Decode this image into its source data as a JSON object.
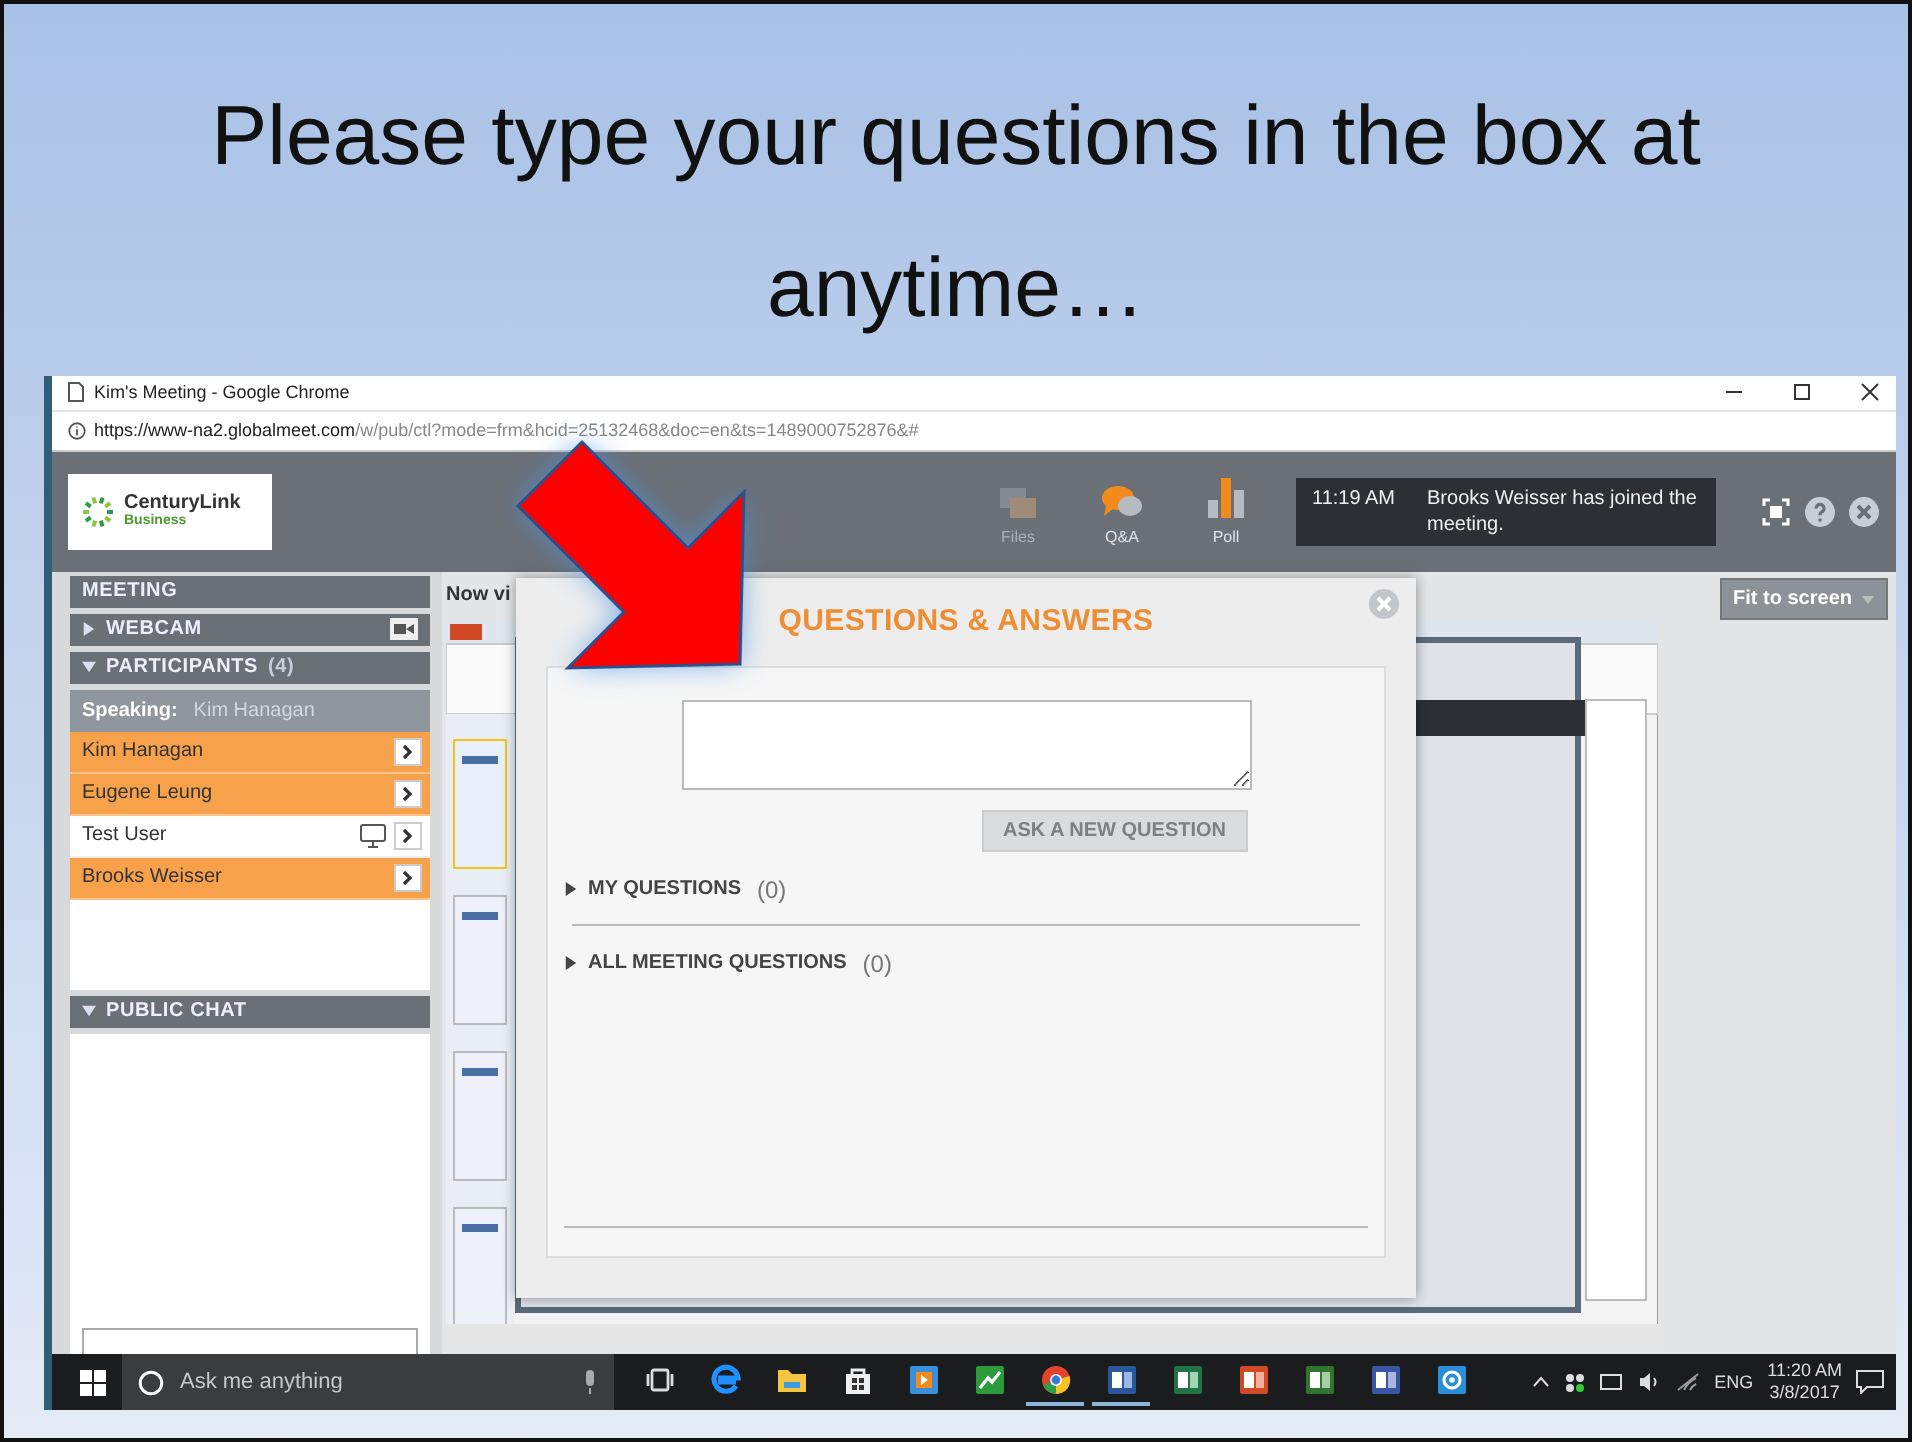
{
  "slide_title": "Please type your questions in the box at anytime…",
  "browser": {
    "title": "Kim's Meeting - Google Chrome",
    "url_host": "https://www-na2.globalmeet.com",
    "url_path": "/w/pub/ctl?mode=frm&hcid=25132468&doc=en&ts=1489000752876&#"
  },
  "header": {
    "logo_name": "CenturyLink",
    "logo_sub": "Business",
    "tools": [
      {
        "kind": "files",
        "label": "Files",
        "disabled": true
      },
      {
        "kind": "qa",
        "label": "Q&A",
        "disabled": false
      },
      {
        "kind": "poll",
        "label": "Poll",
        "disabled": false
      }
    ],
    "notification": {
      "time": "11:19 AM",
      "message": "Brooks Weisser has joined the meeting."
    }
  },
  "sidebar": {
    "heading": "MEETING",
    "webcam": {
      "label": "WEBCAM",
      "expanded": false
    },
    "participants": {
      "label": "PARTICIPANTS",
      "count": "(4)",
      "expanded": true,
      "speaking_label": "Speaking:",
      "speaking_name": "Kim Hanagan",
      "items": [
        {
          "name": "Kim Hanagan",
          "highlighted": true,
          "presenter": false
        },
        {
          "name": "Eugene Leung",
          "highlighted": true,
          "presenter": false
        },
        {
          "name": "Test User",
          "highlighted": false,
          "presenter": true
        },
        {
          "name": "Brooks Weisser",
          "highlighted": true,
          "presenter": false
        }
      ]
    },
    "public_chat": {
      "label": "PUBLIC CHAT",
      "expanded": true
    }
  },
  "content": {
    "now_viewing": "Now vi",
    "fit_button": "Fit to screen"
  },
  "qa_dialog": {
    "title": "QUESTIONS & ANSWERS",
    "ask_button": {
      "label": "ASK A NEW QUESTION",
      "disabled": true
    },
    "sections": [
      {
        "label": "MY QUESTIONS",
        "count": "(0)",
        "expanded": false
      },
      {
        "label": "ALL MEETING QUESTIONS",
        "count": "(0)",
        "expanded": false
      }
    ]
  },
  "taskbar": {
    "search_placeholder": "Ask me anything",
    "apps": [
      {
        "kind": "taskview",
        "running": false
      },
      {
        "kind": "edge",
        "running": false
      },
      {
        "kind": "explorer",
        "running": false
      },
      {
        "kind": "store",
        "running": false
      },
      {
        "kind": "media",
        "running": false
      },
      {
        "kind": "chart",
        "running": false
      },
      {
        "kind": "chrome",
        "running": true
      },
      {
        "kind": "word",
        "running": true
      },
      {
        "kind": "excel",
        "running": false
      },
      {
        "kind": "powerpoint",
        "running": false
      },
      {
        "kind": "project",
        "running": false
      },
      {
        "kind": "visio",
        "running": false
      },
      {
        "kind": "lens",
        "running": false
      }
    ],
    "language": "ENG",
    "time": "11:20 AM",
    "date": "3/8/2017"
  }
}
